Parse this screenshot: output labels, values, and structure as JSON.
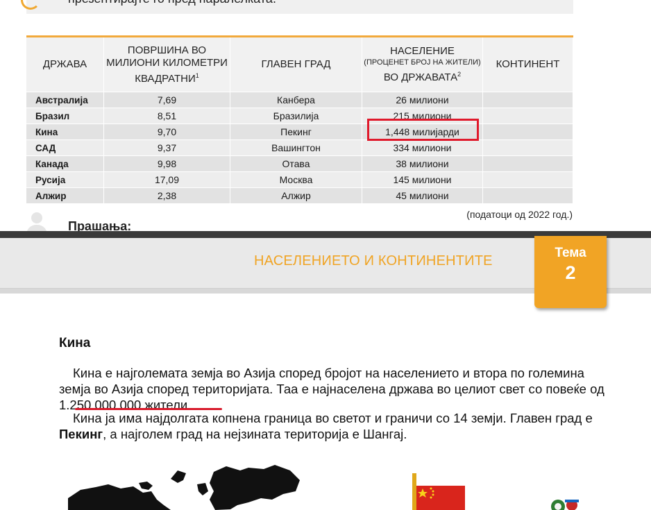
{
  "top_fragment": {
    "text": "презентирајте го пред паралелката."
  },
  "table": {
    "headers": {
      "country": "ДРЖАВА",
      "area": "ПОВРШИНА ВО МИЛИОНИ КИЛОМЕТРИ КВАДРАТНИ",
      "area_sup": "1",
      "capital": "ГЛАВЕН ГРАД",
      "population_top": "НАСЕЛЕНИЕ",
      "population_mid": "(ПРОЦЕНЕТ БРОЈ НА ЖИТЕЛИ)",
      "population_bottom": "ВО ДРЖАВАТА",
      "population_sup": "2",
      "continent": "КОНТИНЕНТ"
    },
    "rows": [
      {
        "country": "Австралија",
        "area": "7,69",
        "capital": "Канбера",
        "population": "26 милиони",
        "continent": ""
      },
      {
        "country": "Бразил",
        "area": "8,51",
        "capital": "Бразилија",
        "population": "215 милиони",
        "continent": ""
      },
      {
        "country": "Кина",
        "area": "9,70",
        "capital": "Пекинг",
        "population": "1,448 милијарди",
        "continent": ""
      },
      {
        "country": "САД",
        "area": "9,37",
        "capital": "Вашингтон",
        "population": "334 милиони",
        "continent": ""
      },
      {
        "country": "Канада",
        "area": "9,98",
        "capital": "Отава",
        "population": "38 милиони",
        "continent": ""
      },
      {
        "country": "Русија",
        "area": "17,09",
        "capital": "Москва",
        "population": "145 милиони",
        "continent": ""
      },
      {
        "country": "Алжир",
        "area": "2,38",
        "capital": "Алжир",
        "population": "45 милиони",
        "continent": ""
      }
    ],
    "source_note": "(податоци од 2022 год.)"
  },
  "questions_heading": "Прашања:",
  "band": {
    "title": "НАСЕЛЕНИЕТО И КОНТИНЕНТИТЕ",
    "tema_label": "Тема",
    "tema_number": "2"
  },
  "section": {
    "title": "Кина",
    "p1_a": "Кина е најголемата земја во Азија според бројот на населението и втора по големина земја во Азија според територијата. Таа е најнаселена држава во целиот свет со повеќе од ",
    "p1_b": "1.250.000.000 жители.",
    "p2_a": "Кина ја има најдолгата копнена граница во светот и граничи со 14 земји. Главен град е ",
    "p2_b": "Пекинг",
    "p2_c": ", а најголем град на нејзината територија е Шангај."
  },
  "colors": {
    "accent": "#f1a425",
    "highlight_red": "#e0192b",
    "table_row": "#e2e2e2"
  }
}
